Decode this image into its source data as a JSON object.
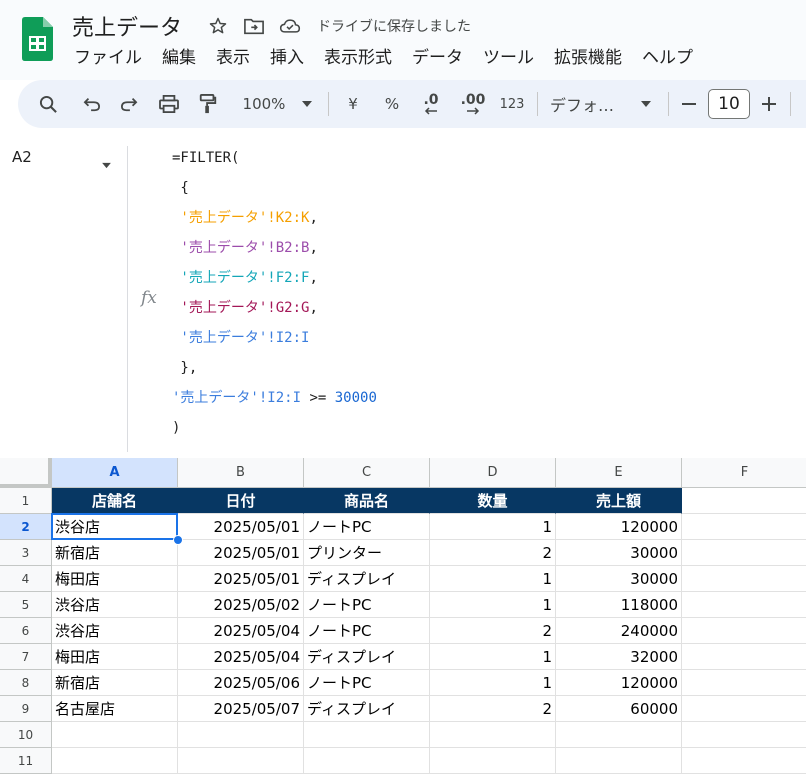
{
  "app": {
    "doc_title": "売上データ",
    "save_status": "ドライブに保存しました"
  },
  "menu": [
    "ファイル",
    "編集",
    "表示",
    "挿入",
    "表示形式",
    "データ",
    "ツール",
    "拡張機能",
    "ヘルプ"
  ],
  "toolbar": {
    "zoom": "100%",
    "currency": "¥",
    "percent": "%",
    "decrease_decimal": ".0",
    "increase_decimal": ".00",
    "number_format": "123",
    "font": "デフォ…",
    "font_size": "10",
    "minus": "—",
    "plus": "+"
  },
  "name_box": "A2",
  "fx_label": "fx",
  "formula_lines": [
    [
      {
        "t": "=FILTER(",
        "c": "default"
      }
    ],
    [
      {
        "t": " {",
        "c": "default"
      }
    ],
    [
      {
        "t": " '売上データ'!K2:K",
        "c": "orange"
      },
      {
        "t": ",",
        "c": "default"
      }
    ],
    [
      {
        "t": " '売上データ'!B2:B",
        "c": "purple"
      },
      {
        "t": ",",
        "c": "default"
      }
    ],
    [
      {
        "t": " '売上データ'!F2:F",
        "c": "teal"
      },
      {
        "t": ",",
        "c": "default"
      }
    ],
    [
      {
        "t": " '売上データ'!G2:G",
        "c": "crimson"
      },
      {
        "t": ",",
        "c": "default"
      }
    ],
    [
      {
        "t": " '売上データ'!I2:I",
        "c": "blue"
      }
    ],
    [
      {
        "t": " },",
        "c": "default"
      }
    ],
    [
      {
        "t": "'売上データ'!I2:I",
        "c": "blue"
      },
      {
        "t": " >= ",
        "c": "default"
      },
      {
        "t": "30000",
        "c": "num"
      }
    ],
    [
      {
        "t": ")",
        "c": "default"
      }
    ]
  ],
  "sheet": {
    "columns": [
      "A",
      "B",
      "C",
      "D",
      "E",
      "F"
    ],
    "row_numbers": [
      "1",
      "2",
      "3",
      "4",
      "5",
      "6",
      "7",
      "8",
      "9",
      "10",
      "11"
    ],
    "header": [
      "店舗名",
      "日付",
      "商品名",
      "数量",
      "売上額"
    ],
    "rows": [
      [
        "渋谷店",
        "2025/05/01",
        "ノートPC",
        "1",
        "120000"
      ],
      [
        "新宿店",
        "2025/05/01",
        "プリンター",
        "2",
        "30000"
      ],
      [
        "梅田店",
        "2025/05/01",
        "ディスプレイ",
        "1",
        "30000"
      ],
      [
        "渋谷店",
        "2025/05/02",
        "ノートPC",
        "1",
        "118000"
      ],
      [
        "渋谷店",
        "2025/05/04",
        "ノートPC",
        "2",
        "240000"
      ],
      [
        "梅田店",
        "2025/05/04",
        "ディスプレイ",
        "1",
        "32000"
      ],
      [
        "新宿店",
        "2025/05/06",
        "ノートPC",
        "1",
        "120000"
      ],
      [
        "名古屋店",
        "2025/05/07",
        "ディスプレイ",
        "2",
        "60000"
      ]
    ],
    "selected_cell": "A2",
    "header_fill": "#073763",
    "selection_color": "#1a73e8"
  }
}
